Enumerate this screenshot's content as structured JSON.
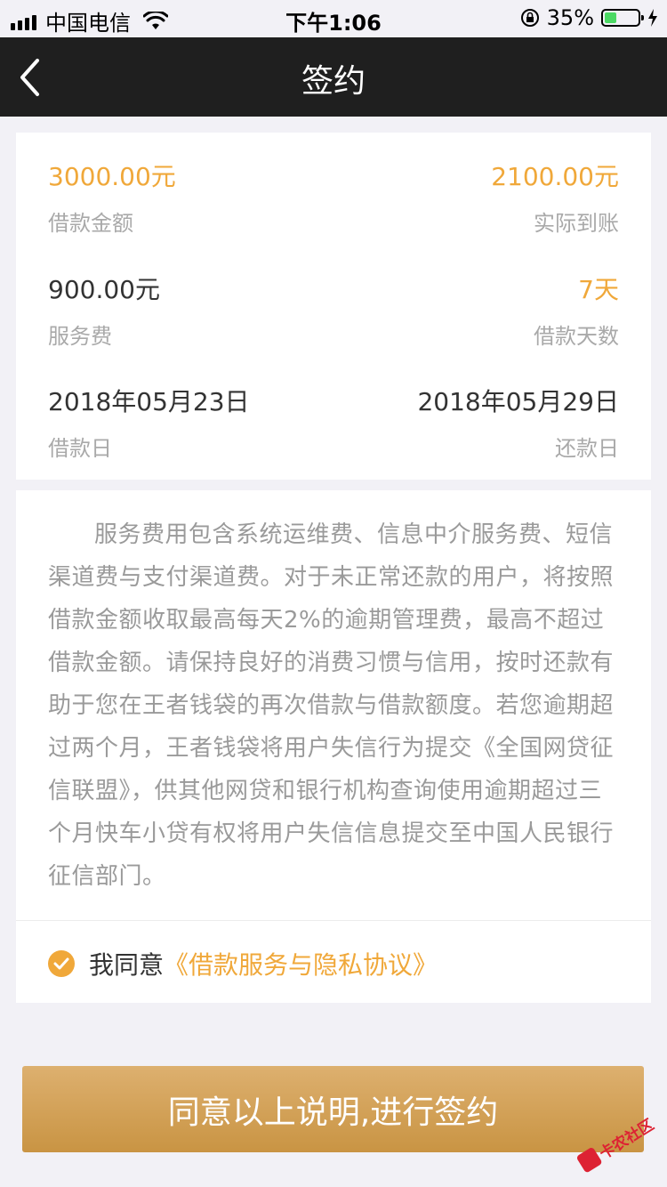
{
  "status_bar": {
    "carrier": "中国电信",
    "time": "下午1:06",
    "battery_percent": "35%",
    "battery_level": 0.35
  },
  "nav": {
    "title": "签约",
    "back_icon": "chevron-left-icon"
  },
  "loan_info": {
    "amount_value": "3000.00元",
    "amount_label": "借款金额",
    "received_value": "2100.00元",
    "received_label": "实际到账",
    "fee_value": "900.00元",
    "fee_label": "服务费",
    "days_value": "7天",
    "days_label": "借款天数",
    "loan_date_value": "2018年05月23日",
    "loan_date_label": "借款日",
    "repay_date_value": "2018年05月29日",
    "repay_date_label": "还款日"
  },
  "terms": {
    "paragraph": "服务费用包含系统运维费、信息中介服务费、短信渠道费与支付渠道费。对于未正常还款的用户，将按照借款金额收取最高每天2%的逾期管理费，最高不超过借款金额。请保持良好的消费习惯与信用，按时还款有助于您在王者钱袋的再次借款与借款额度。若您逾期超过两个月，王者钱袋将用户失信行为提交《全国网贷征信联盟》，供其他网贷和银行机构查询使用逾期超过三个月快车小贷有权将用户失信信息提交至中国人民银行征信部门。"
  },
  "agreement": {
    "prefix": "我同意",
    "link": "《借款服务与隐私协议》",
    "checked": true
  },
  "actions": {
    "sign_label": "同意以上说明,进行签约"
  },
  "watermark": {
    "text": "卡农社区"
  },
  "colors": {
    "accent": "#f0a83a",
    "nav_bg": "#1f1f1f",
    "button_top": "#ddb06f",
    "button_bottom": "#c99443"
  }
}
